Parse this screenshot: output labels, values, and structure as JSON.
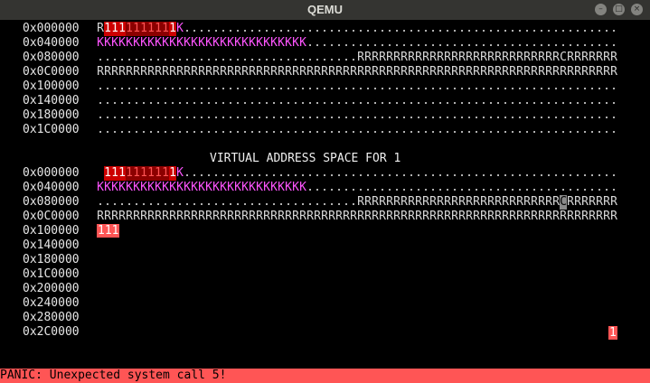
{
  "window": {
    "title": "QEMU"
  },
  "section1": {
    "rows": [
      {
        "addr": "0x000000",
        "cells": "R1111111111K............................................................"
      },
      {
        "addr": "0x040000",
        "cells": "KKKKKKKKKKKKKKKKKKKKKKKKKKKKK.............................................K"
      },
      {
        "addr": "0x080000",
        "cells": "....................................RRRRRRRRRRRRRRRRRRRRRRRRRRRRCRRRRRRR"
      },
      {
        "addr": "0x0C0000",
        "cells": "RRRRRRRRRRRRRRRRRRRRRRRRRRRRRRRRRRRRRRRRRRRRRRRRRRRRRRRRRRRRRRRRRRRRRRRR"
      },
      {
        "addr": "0x100000",
        "cells": "........................................................................"
      },
      {
        "addr": "0x140000",
        "cells": "........................................................................"
      },
      {
        "addr": "0x180000",
        "cells": "........................................................................"
      },
      {
        "addr": "0x1C0000",
        "cells": "........................................................................"
      }
    ]
  },
  "heading": "VIRTUAL ADDRESS SPACE FOR 1",
  "section2": {
    "rows": [
      {
        "addr": "0x000000",
        "cells": " 1111111111K............................................................"
      },
      {
        "addr": "0x040000",
        "cells": "KKKKKKKKKKKKKKKKKKKKKKKKKKKKK.............................................K"
      },
      {
        "addr": "0x080000",
        "cells": "....................................RRRRRRRRRRRRRRRRRRRRRRRRRRRRCRRRRRRR"
      },
      {
        "addr": "0x0C0000",
        "cells": "RRRRRRRRRRRRRRRRRRRRRRRRRRRRRRRRRRRRRRRRRRRRRRRRRRRRRRRRRRRRRRRRRRRRRRRR"
      },
      {
        "addr": "0x100000",
        "cells": "111"
      },
      {
        "addr": "0x140000",
        "cells": ""
      },
      {
        "addr": "0x180000",
        "cells": ""
      },
      {
        "addr": "0x1C0000",
        "cells": ""
      },
      {
        "addr": "0x200000",
        "cells": ""
      },
      {
        "addr": "0x240000",
        "cells": ""
      },
      {
        "addr": "0x280000",
        "cells": ""
      },
      {
        "addr": "0x2C0000",
        "cells": ""
      }
    ],
    "stack_marker": "1"
  },
  "status": {
    "panic_message": "PANIC: Unexpected system call 5!"
  },
  "colors": {
    "kernel": "#ff55ff",
    "reserved": "#d8d8d8",
    "process": "#ff5555",
    "panic_bar": "#ff5555"
  }
}
